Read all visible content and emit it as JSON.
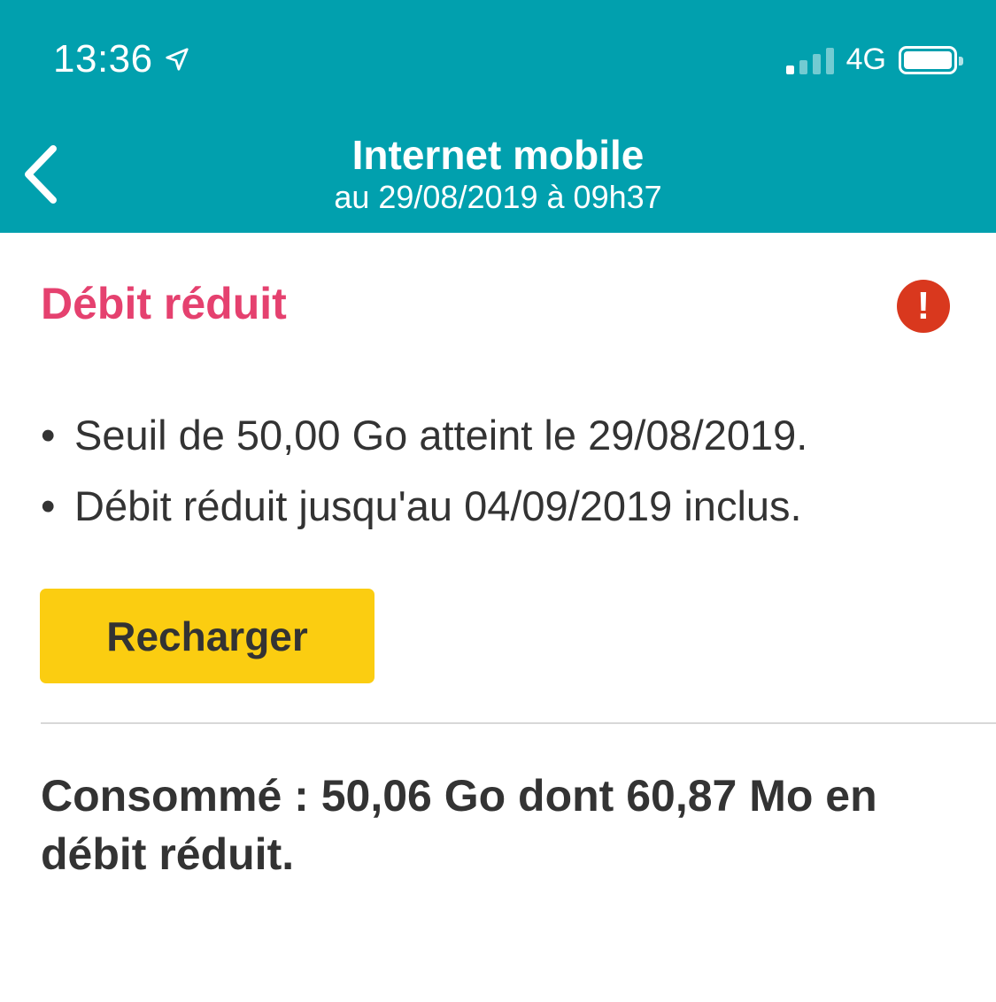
{
  "status_bar": {
    "time": "13:36",
    "network": "4G",
    "signal_bars_on": 1,
    "signal_bars_total": 4
  },
  "header": {
    "title": "Internet mobile",
    "subtitle": "au 29/08/2019 à 09h37",
    "background_color": "#01a0ae"
  },
  "alert": {
    "title": "Débit réduit",
    "title_color": "#e5416f",
    "icon_glyph": "!",
    "icon_color": "#d9381e"
  },
  "bullets": [
    "Seuil de 50,00 Go atteint le 29/08/2019.",
    "Débit réduit jusqu'au 04/09/2019 inclus."
  ],
  "bullet_marker": "•",
  "actions": {
    "recharge_label": "Recharger",
    "button_color": "#fbcd11"
  },
  "consumption": {
    "text": "Consommé : 50,06 Go dont 60,87 Mo en débit réduit."
  }
}
